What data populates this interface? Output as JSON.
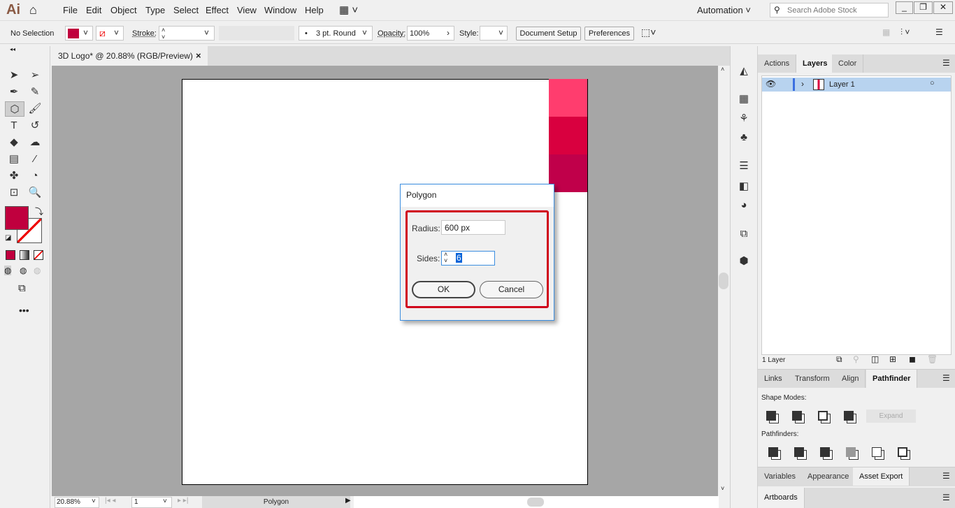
{
  "app": {
    "logo": "Ai",
    "menus": [
      "File",
      "Edit",
      "Object",
      "Type",
      "Select",
      "Effect",
      "View",
      "Window",
      "Help"
    ],
    "workspace": "Automation",
    "search_placeholder": "Search Adobe Stock"
  },
  "control_bar": {
    "selection": "No Selection",
    "fill_color": "#c0003e",
    "stroke_label": "Stroke:",
    "brush": "3 pt. Round",
    "opacity_label": "Opacity:",
    "opacity": "100%",
    "style_label": "Style:",
    "document_setup": "Document Setup",
    "preferences": "Preferences"
  },
  "document": {
    "tab_title": "3D Logo* @ 20.88% (RGB/Preview)",
    "close": "×"
  },
  "swatches": [
    "#ff3d6e",
    "#d9003f",
    "#c0004a"
  ],
  "dialog": {
    "title": "Polygon",
    "radius_label": "Radius:",
    "radius": "600 px",
    "sides_label": "Sides:",
    "sides": "6",
    "ok": "OK",
    "cancel": "Cancel"
  },
  "layers_panel": {
    "tabs": [
      "Actions",
      "Layers",
      "Color"
    ],
    "active": "Layers",
    "layer_name": "Layer 1",
    "count": "1 Layer"
  },
  "pathfinder_panel": {
    "tabs": [
      "Links",
      "Transform",
      "Align",
      "Pathfinder"
    ],
    "active": "Pathfinder",
    "shape_modes": "Shape Modes:",
    "expand": "Expand",
    "pathfinders": "Pathfinders:"
  },
  "bottom_panel": {
    "tabs": [
      "Variables",
      "Appearance",
      "Asset Export"
    ],
    "active": "Asset Export"
  },
  "artboards_panel": {
    "tab": "Artboards"
  },
  "status": {
    "zoom": "20.88%",
    "artboard": "1",
    "tool": "Polygon"
  }
}
